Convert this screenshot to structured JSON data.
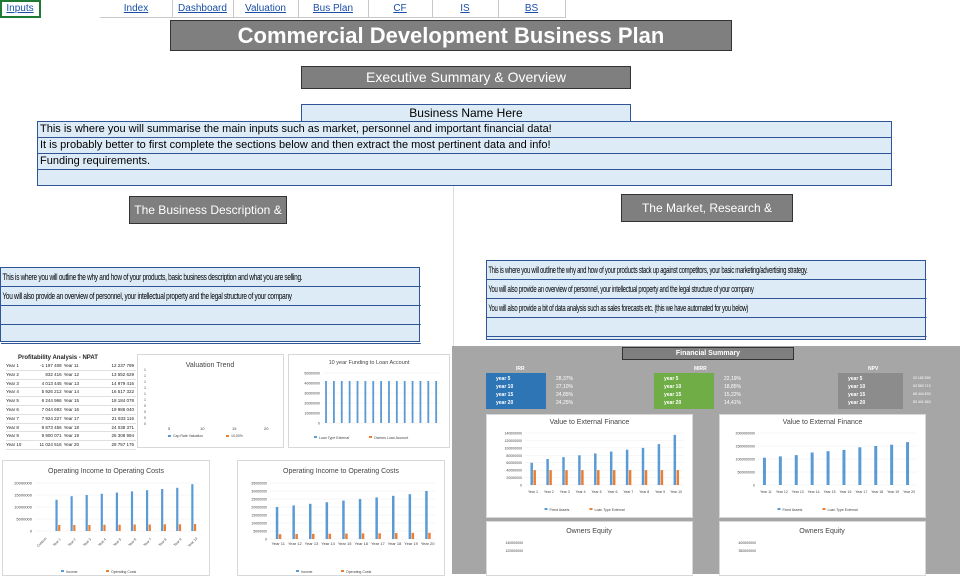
{
  "nav": {
    "tabs": [
      "Inputs",
      "Index",
      "Dashboard",
      "Valuation",
      "Bus Plan",
      "CF",
      "IS",
      "BS"
    ],
    "selected": "Inputs"
  },
  "title": "Commercial Development Business Plan",
  "exec_header": "Executive Summary & Overview",
  "business_name": "Business Name Here",
  "exec_rows": [
    "This is where you will summarise the main inputs such as market, personnel and important financial data!",
    "It is probably better to first complete the sections below and then extract the most pertinent data and info!",
    "Funding requirements.",
    ""
  ],
  "left_section": {
    "header": "The Business Description & Structure",
    "rows": [
      "This is where you will outline the why and how of your products, basic business description and what you are selling.",
      "You will also provide an overview of personnel, your intellectual property and the legal structure of your company",
      "",
      ""
    ]
  },
  "right_section": {
    "header": "The Market, Research & Strategies",
    "rows": [
      "This is where you will outline the why and how of your products stack up against competitors, your basic marketing/advertising strategy.",
      "You will also provide an overview of personnel, your intellectual property and the legal structure of your company",
      "You will also provide a bit of data analysis such as sales forecasts etc. (this we have automated for you below)",
      ""
    ]
  },
  "profitability": {
    "title": "Profitability Analysis - NPAT",
    "rows": [
      [
        "Year 1",
        "-1 197 408",
        "Year 11",
        "12 237 799"
      ],
      [
        "Year 2",
        "832 416",
        "Year 12",
        "13 552 629"
      ],
      [
        "Year 3",
        "4 013 445",
        "Year 13",
        "14 979 416"
      ],
      [
        "Year 4",
        "5 926 212",
        "Year 14",
        "16 517 322"
      ],
      [
        "Year 5",
        "6 244 966",
        "Year 15",
        "18 184 078"
      ],
      [
        "Year 6",
        "7 044 693",
        "Year 16",
        "19 986 040"
      ],
      [
        "Year 7",
        "7 924 227",
        "Year 17",
        "21 933 116"
      ],
      [
        "Year 8",
        "8 873 456",
        "Year 18",
        "24 038 371"
      ],
      [
        "Year 9",
        "9 900 071",
        "Year 19",
        "26 308 994"
      ],
      [
        "Year 10",
        "11 024 516",
        "Year 20",
        "28 757 176"
      ]
    ]
  },
  "financial_summary": {
    "title": "Financial Summary",
    "blocks": [
      {
        "name": "IRR",
        "color": "#2e75b6",
        "labels": [
          "year 5",
          "year 10",
          "year 15",
          "year 20"
        ],
        "values": [
          "28,37%",
          "27,10%",
          "24,85%",
          "24,25%"
        ]
      },
      {
        "name": "MIRR",
        "color": "#70ad47",
        "labels": [
          "year 5",
          "year 10",
          "year 15",
          "year 20"
        ],
        "values": [
          "22,19%",
          "18,85%",
          "15,22%",
          "14,41%"
        ]
      },
      {
        "name": "NPV",
        "color": "#8c8c8c",
        "labels": [
          "year 5",
          "year 10",
          "year 15",
          "year 20"
        ],
        "values": [
          "20 182 599",
          "63 569 713",
          "68 444 633",
          "83 441 663"
        ]
      }
    ]
  },
  "charts": {
    "valuation": {
      "title": "Valuation Trend",
      "yticks": [
        "1",
        "1",
        "1",
        "1",
        "1",
        "1",
        "0",
        "0",
        "0",
        "0"
      ],
      "xticks": [
        "5",
        "10",
        "15",
        "20"
      ],
      "legend": [
        "Cap Rate Valuation",
        "10,00%"
      ]
    },
    "funding": {
      "title": "10 year Funding to Loan Account",
      "yticks": [
        "50000000",
        "40000000",
        "30000000",
        "20000000",
        "10000000",
        "0"
      ],
      "legend": [
        "Loan Type External",
        "Owners Loan Account"
      ]
    },
    "op_left": {
      "title": "Operating Income to Operating Costs",
      "yticks": [
        "20000000",
        "15000000",
        "10000000",
        "5000000",
        "0"
      ],
      "legend": [
        "Income",
        "Operating Costs"
      ]
    },
    "op_right": {
      "title": "Operating Income to Operating Costs",
      "yticks": [
        "35000000",
        "30000000",
        "25000000",
        "20000000",
        "15000000",
        "10000000",
        "5000000",
        "0"
      ],
      "legend": [
        "Income",
        "Operating Costs"
      ]
    },
    "vef1": {
      "title": "Value to External Finance",
      "yticks": [
        "140000000",
        "120000000",
        "100000000",
        "80000000",
        "60000000",
        "40000000",
        "20000000",
        "0"
      ],
      "legend": [
        "Fixed Assets",
        "Loan Type External"
      ]
    },
    "vef2": {
      "title": "Value to External Finance",
      "yticks": [
        "2000000000",
        "1500000000",
        "1000000000",
        "500000000",
        "0"
      ],
      "legend": [
        "Fixed Assets",
        "Loan Type External"
      ]
    },
    "oe1": {
      "title": "Owners Equity",
      "yticks": [
        "140000000",
        "120000000"
      ]
    },
    "oe2": {
      "title": "Owners Equity",
      "yticks": [
        "400000000",
        "350000000"
      ]
    }
  },
  "chart_data": [
    {
      "type": "bar",
      "title": "10 year Funding to Loan Account",
      "series": [
        {
          "name": "Loan Type External",
          "values": [
            42000000,
            42000000,
            42000000,
            42000000,
            42000000,
            42000000,
            42000000,
            42000000,
            42000000,
            42000000,
            42000000,
            42000000,
            42000000,
            42000000,
            42000000
          ]
        },
        {
          "name": "Owners Loan Account",
          "values": [
            0,
            0,
            0,
            0,
            0,
            0,
            0,
            0,
            0,
            0,
            0,
            0,
            0,
            0,
            0
          ]
        }
      ],
      "ylim": [
        0,
        50000000
      ]
    },
    {
      "type": "bar",
      "title": "Operating Income to Operating Costs",
      "categories": [
        "Custom",
        "Year 1",
        "Year 2",
        "Year 3",
        "Year 4",
        "Year 5",
        "Year 6",
        "Year 7",
        "Year 8",
        "Year 9",
        "Year 10"
      ],
      "series": [
        {
          "name": "Income",
          "values": [
            0,
            13000000,
            14500000,
            15000000,
            15500000,
            16000000,
            16500000,
            17000000,
            17500000,
            18000000,
            19500000
          ]
        },
        {
          "name": "Operating Costs",
          "values": [
            0,
            2500000,
            2500000,
            2500000,
            2600000,
            2600000,
            2700000,
            2700000,
            2800000,
            2800000,
            2900000
          ]
        }
      ],
      "ylim": [
        0,
        20000000
      ]
    },
    {
      "type": "bar",
      "title": "Operating Income to Operating Costs",
      "categories": [
        "Year 11",
        "Year 12",
        "Year 13",
        "Year 14",
        "Year 15",
        "Year 16",
        "Year 17",
        "Year 18",
        "Year 19",
        "Year 20"
      ],
      "series": [
        {
          "name": "Income",
          "values": [
            20000000,
            21000000,
            22000000,
            23000000,
            24000000,
            25000000,
            26000000,
            27000000,
            28000000,
            30000000
          ]
        },
        {
          "name": "Operating Costs",
          "values": [
            3000000,
            3100000,
            3200000,
            3300000,
            3400000,
            3500000,
            3600000,
            3700000,
            3800000,
            3900000
          ]
        }
      ],
      "ylim": [
        0,
        35000000
      ]
    },
    {
      "type": "bar",
      "title": "Value to External Finance",
      "categories": [
        "Year 1",
        "Year 2",
        "Year 3",
        "Year 4",
        "Year 5",
        "Year 6",
        "Year 7",
        "Year 8",
        "Year 9",
        "Year 10"
      ],
      "series": [
        {
          "name": "Fixed Assets",
          "values": [
            60000000,
            70000000,
            75000000,
            80000000,
            85000000,
            90000000,
            95000000,
            100000000,
            110000000,
            135000000
          ]
        },
        {
          "name": "Loan Type External",
          "values": [
            40000000,
            40000000,
            40000000,
            40000000,
            40000000,
            40000000,
            40000000,
            40000000,
            40000000,
            40000000
          ]
        }
      ],
      "ylim": [
        0,
        140000000
      ]
    },
    {
      "type": "bar",
      "title": "Value to External Finance",
      "categories": [
        "Year 11",
        "Year 12",
        "Year 13",
        "Year 14",
        "Year 15",
        "Year 16",
        "Year 17",
        "Year 18",
        "Year 19",
        "Year 20"
      ],
      "series": [
        {
          "name": "Fixed Assets",
          "values": [
            1050000000,
            1100000000,
            1150000000,
            1250000000,
            1300000000,
            1350000000,
            1450000000,
            1500000000,
            1550000000,
            1650000000
          ]
        },
        {
          "name": "Loan Type External",
          "values": [
            0,
            0,
            0,
            0,
            0,
            0,
            0,
            0,
            0,
            0
          ]
        }
      ],
      "ylim": [
        0,
        2000000000
      ]
    }
  ]
}
